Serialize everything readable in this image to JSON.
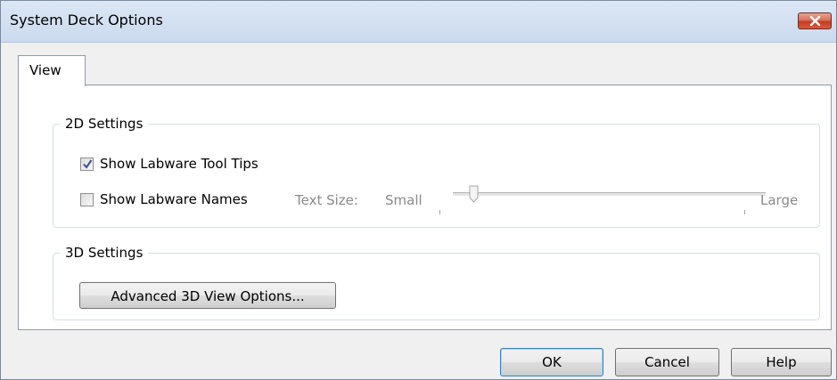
{
  "window": {
    "title": "System Deck Options"
  },
  "tabs": [
    {
      "label": "View"
    }
  ],
  "settings_2d": {
    "legend": "2D Settings",
    "show_tool_tips": {
      "label": "Show Labware Tool Tips",
      "checked": true
    },
    "show_names": {
      "label": "Show Labware Names",
      "checked": false
    },
    "text_size": {
      "label": "Text Size:",
      "min_label": "Small",
      "max_label": "Large",
      "value": 0.05,
      "enabled": false
    }
  },
  "settings_3d": {
    "legend": "3D Settings",
    "advanced_button": "Advanced 3D View Options..."
  },
  "footer": {
    "ok": "OK",
    "cancel": "Cancel",
    "help": "Help"
  },
  "icons": {
    "close": "close-icon",
    "check": "checkmark-icon"
  },
  "colors": {
    "close_button": "#c43a1f",
    "titlebar": "#cbdaee"
  }
}
